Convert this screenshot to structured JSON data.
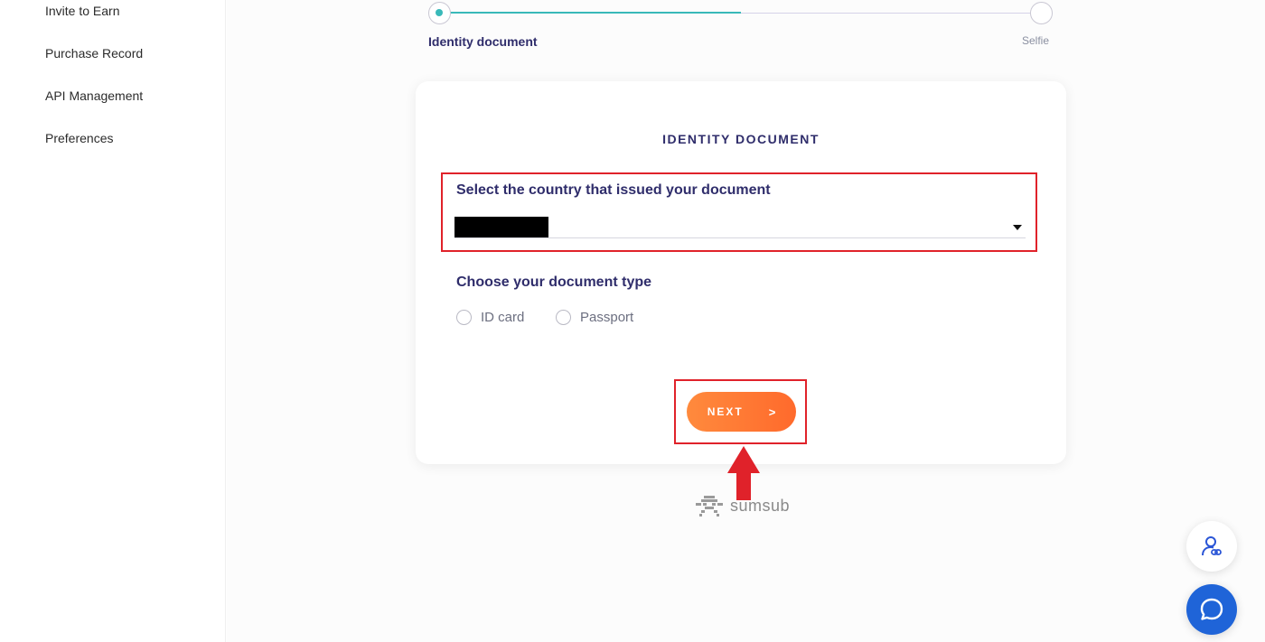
{
  "sidebar": {
    "items": [
      {
        "label": "Invite to Earn"
      },
      {
        "label": "Purchase Record"
      },
      {
        "label": "API Management"
      },
      {
        "label": "Preferences"
      }
    ]
  },
  "stepper": {
    "steps": [
      {
        "label": "Identity document",
        "state": "active"
      },
      {
        "label": "Selfie",
        "state": "pending"
      }
    ],
    "accent_color": "#39b9b9"
  },
  "card": {
    "title": "IDENTITY DOCUMENT",
    "country": {
      "label": "Select the country that issued your document",
      "selected_value": ""
    },
    "document_type": {
      "label": "Choose your document type",
      "options": [
        {
          "label": "ID card",
          "checked": false
        },
        {
          "label": "Passport",
          "checked": false
        }
      ]
    },
    "next_button": {
      "label": "NEXT",
      "arrow": ">"
    }
  },
  "branding": {
    "logo_text": "sumsub"
  },
  "colors": {
    "heading": "#2f2d6b",
    "annotation": "#e0222a",
    "button_gradient_start": "#ff8a3d",
    "button_gradient_end": "#ff6a2c",
    "chat_button": "#1f64d8"
  },
  "icons": {
    "profile_button": "person-link-icon",
    "chat_button": "chat-bubble-icon",
    "select_caret": "caret-down-icon"
  }
}
